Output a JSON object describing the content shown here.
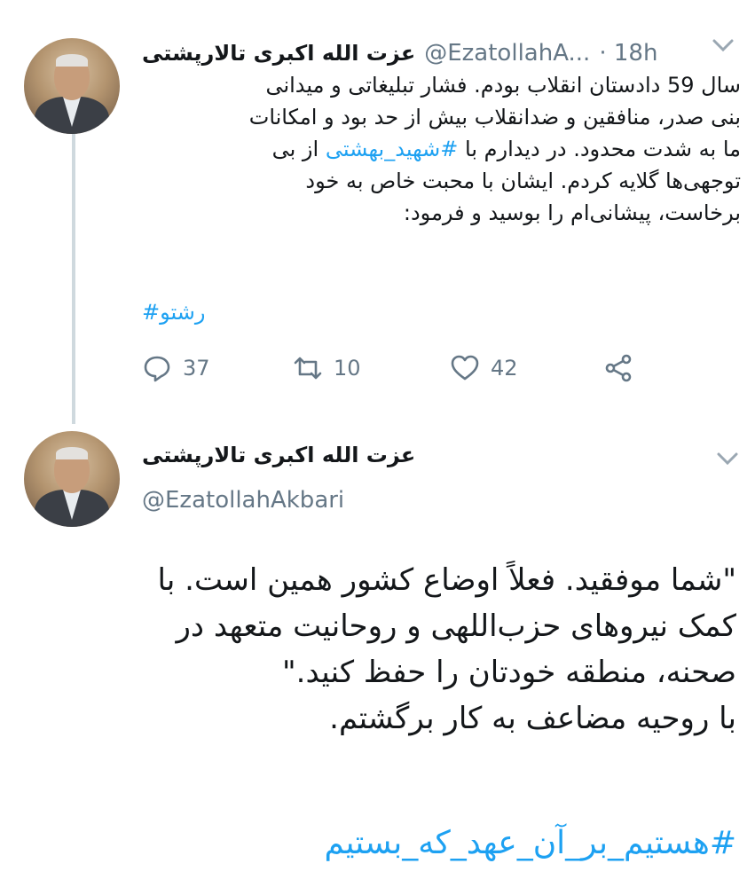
{
  "tweet1": {
    "name": "عزت الله اکبری تالارپشتی",
    "handle": "@EzatollahA...",
    "time": "· 18h",
    "lines": [
      "سال 59 دادستان انقلاب بودم. فشار تبلیغاتی و میدانی",
      "بنی صدر، منافقین و ضدانقلاب بیش از حد بود و امکانات",
      "ما به شدت محدود. در دیدارم با",
      "#شهید_بهشتی",
      "از بی",
      "توجهی‌ها گلایه کردم. ایشان با محبت خاص به خود",
      "برخاست، پیشانی‌ام را بوسید و فرمود:"
    ],
    "hashtag": "#رشتو",
    "replies": "37",
    "retweets": "10",
    "likes": "42"
  },
  "tweet2": {
    "name": "عزت الله اکبری تالارپشتی",
    "handle": "@EzatollahAkbari",
    "lines": [
      "\"شما موفقید. فعلاً اوضاع کشور همین است. با",
      "کمک نیروهای حزب‌اللهی و روحانیت متعهد در",
      "صحنه، منطقه خودتان را حفظ کنید.\"",
      "با روحیه مضاعف به کار برگشتم."
    ],
    "hashtag": "#هستیم_بر_آن_عهد_که_بستیم"
  },
  "icons": [
    "chevron-down-icon",
    "reply-icon",
    "retweet-icon",
    "like-icon",
    "share-icon"
  ],
  "colors": {
    "accent": "#1da1f2",
    "secondary_text": "#657786",
    "thread_line": "#cfd9de"
  }
}
